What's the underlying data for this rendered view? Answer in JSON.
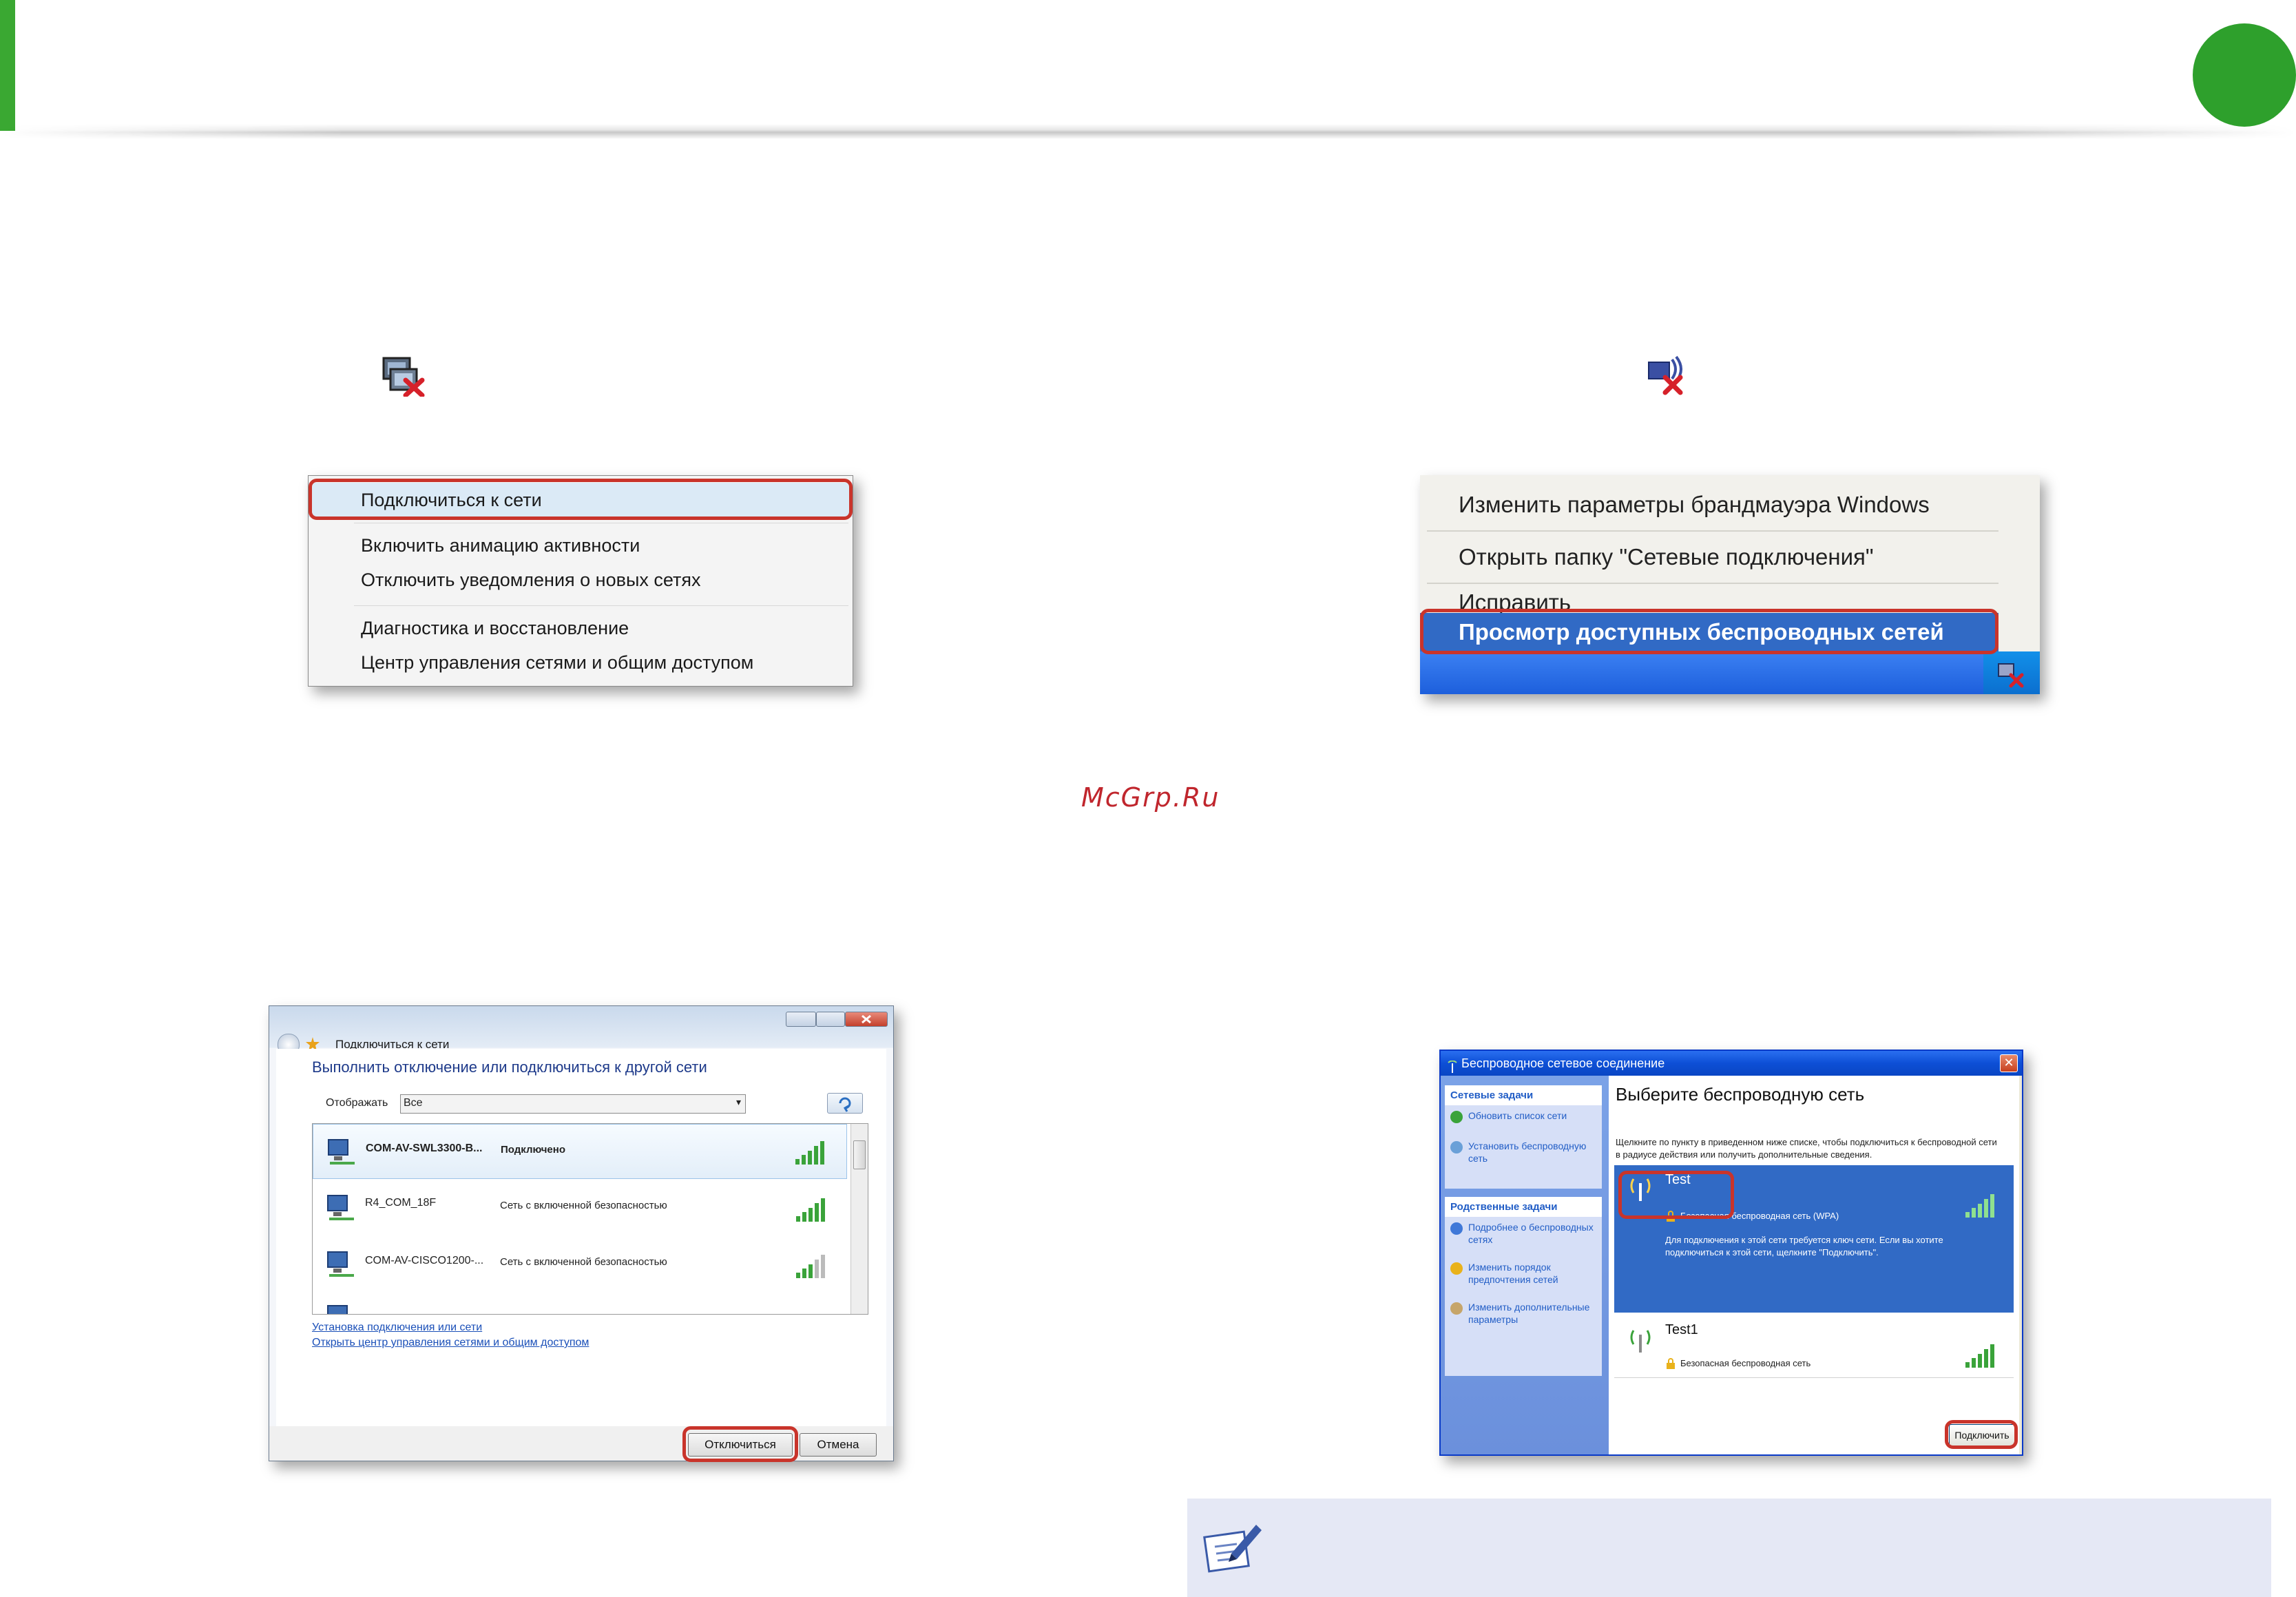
{
  "page": {
    "watermark": "McGrp.Ru"
  },
  "colors": {
    "accent_green": "#3aa832",
    "highlight_red": "#c9342b",
    "xp_selection": "#316ac5"
  },
  "icons": {
    "tray_win7": "network-disconnected-icon",
    "tray_xp": "wireless-disconnected-icon",
    "note": "note-pencil-icon"
  },
  "menu_win7": {
    "items": [
      "Подключиться к сети",
      "Включить анимацию активности",
      "Отключить уведомления о новых сетях",
      "Диагностика и восстановление",
      "Центр управления сетями и общим доступом"
    ],
    "highlighted_index": 0
  },
  "menu_xp": {
    "items": [
      "Изменить параметры брандмауэра Windows",
      "Открыть папку \"Сетевые подключения\"",
      "Исправить",
      "Просмотр доступных беспроводных сетей"
    ],
    "selected_index": 3
  },
  "dialog_win7": {
    "title": "Подключиться к сети",
    "heading": "Выполнить отключение или подключиться к другой сети",
    "show_label": "Отображать",
    "show_value": "Все",
    "networks": [
      {
        "name": "COM-AV-SWL3300-B...",
        "status": "Подключено"
      },
      {
        "name": "R4_COM_18F",
        "status": "Сеть с включенной безопасностью"
      },
      {
        "name": "COM-AV-CISCO1200-...",
        "status": "Сеть с включенной безопасностью"
      }
    ],
    "links": [
      "Установка подключения или сети",
      "Открыть центр управления сетями и общим доступом"
    ],
    "buttons": {
      "disconnect": "Отключиться",
      "cancel": "Отмена"
    }
  },
  "dialog_xp": {
    "title": "Беспроводное сетевое соединение",
    "tasks_header": "Сетевые задачи",
    "tasks": [
      "Обновить список сети",
      "Установить беспроводную сеть"
    ],
    "related_header": "Родственные задачи",
    "related": [
      "Подробнее о беспроводных сетях",
      "Изменить порядок предпочтения сетей",
      "Изменить дополнительные параметры"
    ],
    "heading": "Выберите беспроводную сеть",
    "instruction": "Щелкните по пункту в приведенном ниже списке, чтобы подключиться к беспроводной сети в радиусе действия или получить дополнительные сведения.",
    "networks": [
      {
        "name": "Test",
        "type": "Безопасная беспроводная сеть (WPA)",
        "details": "Для подключения к этой сети требуется ключ сети. Если вы хотите подключиться к этой сети, щелкните \"Подключить\"."
      },
      {
        "name": "Test1",
        "type": "Безопасная беспроводная сеть"
      }
    ],
    "connect_button": "Подключить"
  }
}
